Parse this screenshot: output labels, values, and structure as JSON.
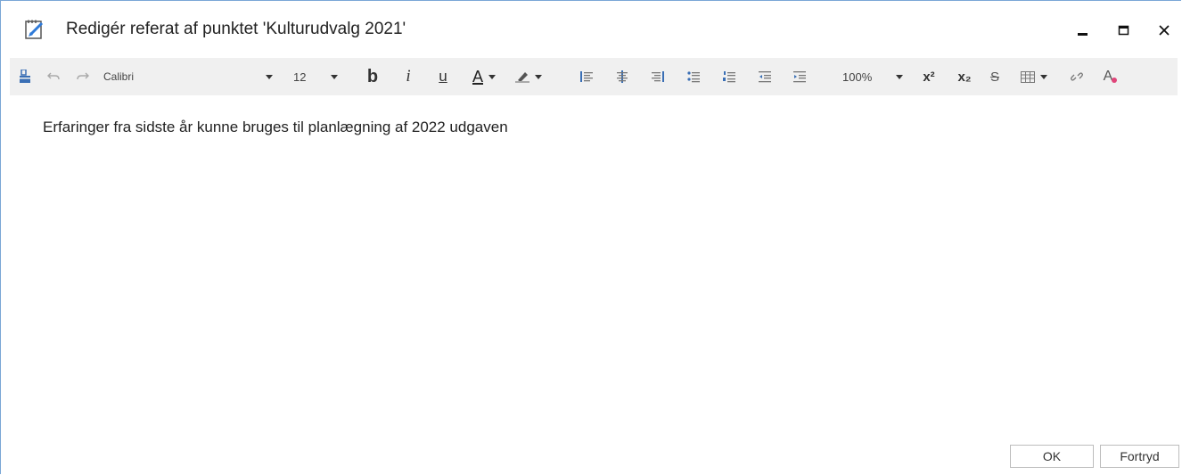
{
  "window": {
    "title": "Redigér referat af punktet 'Kulturudvalg 2021'"
  },
  "toolbar": {
    "font_name": "Calibri",
    "font_size": "12",
    "bold_label": "b",
    "italic_label": "i",
    "underline_label": "u",
    "font_color_label": "A",
    "zoom": "100%",
    "superscript_label": "x²",
    "subscript_label": "x₂",
    "strikethrough_label": "S",
    "clear_format_label": "A"
  },
  "editor": {
    "content": "Erfaringer fra sidste år kunne bruges til planlægning af 2022 udgaven"
  },
  "buttons": {
    "ok": "OK",
    "cancel": "Fortryd"
  },
  "colors": {
    "accent": "#2f7ad8",
    "toolbar_bg": "#f0f0f0",
    "border": "#7aa7d6"
  }
}
